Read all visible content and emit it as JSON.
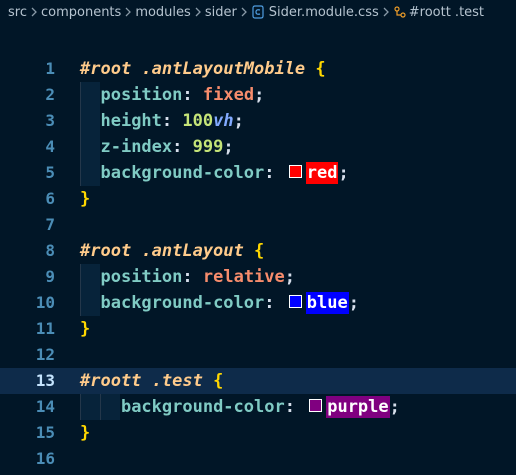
{
  "breadcrumb": {
    "items": [
      "src",
      "components",
      "modules",
      "sider",
      "Sider.module.css",
      "#roott .test"
    ]
  },
  "colors": {
    "background": "#011627",
    "current_line": "#0e2b4a",
    "line_number": "#4b8db6",
    "red": "#ff0000",
    "blue": "#0000ff",
    "purple": "#800080"
  },
  "editor": {
    "lines": [
      {
        "num": "1"
      },
      {
        "num": "2"
      },
      {
        "num": "3"
      },
      {
        "num": "4"
      },
      {
        "num": "5"
      },
      {
        "num": "6"
      },
      {
        "num": "7"
      },
      {
        "num": "8"
      },
      {
        "num": "9"
      },
      {
        "num": "10"
      },
      {
        "num": "11"
      },
      {
        "num": "12"
      },
      {
        "num": "13"
      },
      {
        "num": "14"
      },
      {
        "num": "15"
      },
      {
        "num": "16"
      }
    ],
    "tokens": {
      "sel1": "#root .antLayoutMobile",
      "sel2": "#root .antLayout",
      "sel3": "#roott .test",
      "open_brace": "{",
      "close_brace": "}",
      "position": "position",
      "height": "height",
      "z_index": "z-index",
      "background_color": "background-color",
      "colon": ":",
      "semi": ";",
      "fixed": "fixed",
      "relative": "relative",
      "hundred": "100",
      "vh": "vh",
      "nine99": "999",
      "red": "red",
      "blue": "blue",
      "purple": "purple"
    }
  }
}
